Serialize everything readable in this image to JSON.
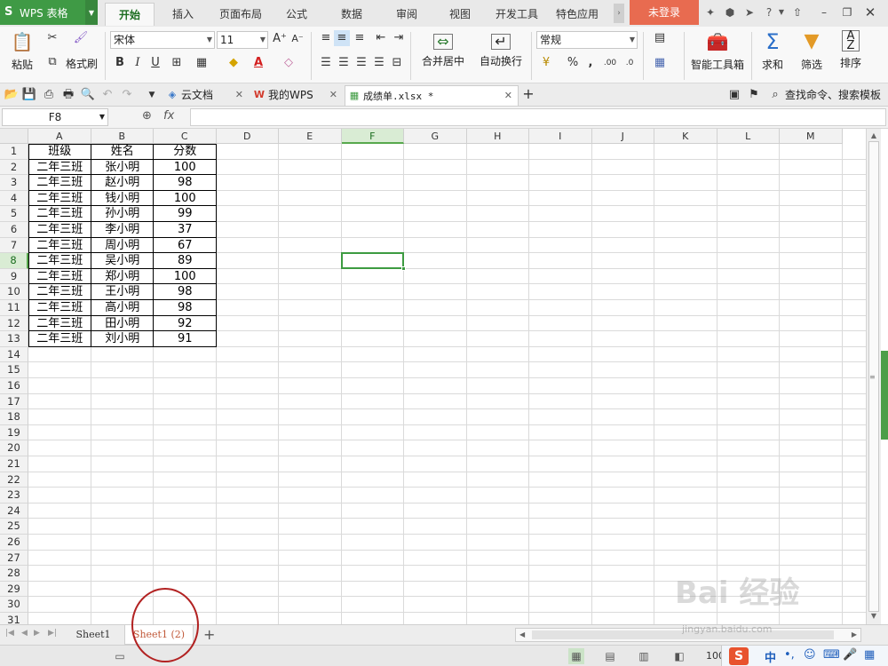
{
  "titlebar": {
    "app_name": "WPS 表格",
    "tabs": [
      "开始",
      "插入",
      "页面布局",
      "公式",
      "数据",
      "审阅",
      "视图",
      "开发工具",
      "特色应用"
    ],
    "login": "未登录"
  },
  "ribbon": {
    "paste": "粘贴",
    "format_painter": "格式刷",
    "font_name": "宋体",
    "font_size": "11",
    "merge_center": "合并居中",
    "wrap_text": "自动换行",
    "number_format": "常规",
    "smart_toolbox": "智能工具箱",
    "sum": "求和",
    "filter": "筛选",
    "sort": "排序"
  },
  "doc_tabs": {
    "items": [
      {
        "label": "云文档"
      },
      {
        "label": "我的WPS"
      },
      {
        "label": "成绩单.xlsx *"
      }
    ],
    "search": "查找命令、搜索模板"
  },
  "formula_bar": {
    "name_box": "F8",
    "fx": "fx",
    "value": ""
  },
  "grid": {
    "columns": [
      "A",
      "B",
      "C",
      "D",
      "E",
      "F",
      "G",
      "H",
      "I",
      "J",
      "K",
      "L",
      "M"
    ],
    "row_count": 31,
    "selected_cell": "F8",
    "rows": [
      [
        "班级",
        "姓名",
        "分数"
      ],
      [
        "二年三班",
        "张小明",
        "100"
      ],
      [
        "二年三班",
        "赵小明",
        "98"
      ],
      [
        "二年三班",
        "钱小明",
        "100"
      ],
      [
        "二年三班",
        "孙小明",
        "99"
      ],
      [
        "二年三班",
        "李小明",
        "37"
      ],
      [
        "二年三班",
        "周小明",
        "67"
      ],
      [
        "二年三班",
        "吴小明",
        "89"
      ],
      [
        "二年三班",
        "郑小明",
        "100"
      ],
      [
        "二年三班",
        "王小明",
        "98"
      ],
      [
        "二年三班",
        "高小明",
        "98"
      ],
      [
        "二年三班",
        "田小明",
        "92"
      ],
      [
        "二年三班",
        "刘小明",
        "91"
      ]
    ]
  },
  "sheets": {
    "tabs": [
      "Sheet1",
      "Sheet1 (2)"
    ],
    "active": "Sheet1 (2)"
  },
  "status": {
    "zoom": "100"
  },
  "ime": {
    "lang": "中"
  },
  "watermark": {
    "logo": "Bai 经验",
    "url": "jingyan.baidu.com"
  },
  "colors": {
    "accent_green": "#3d9b41",
    "login_orange": "#e86b50",
    "annotation_red": "#b22222"
  }
}
